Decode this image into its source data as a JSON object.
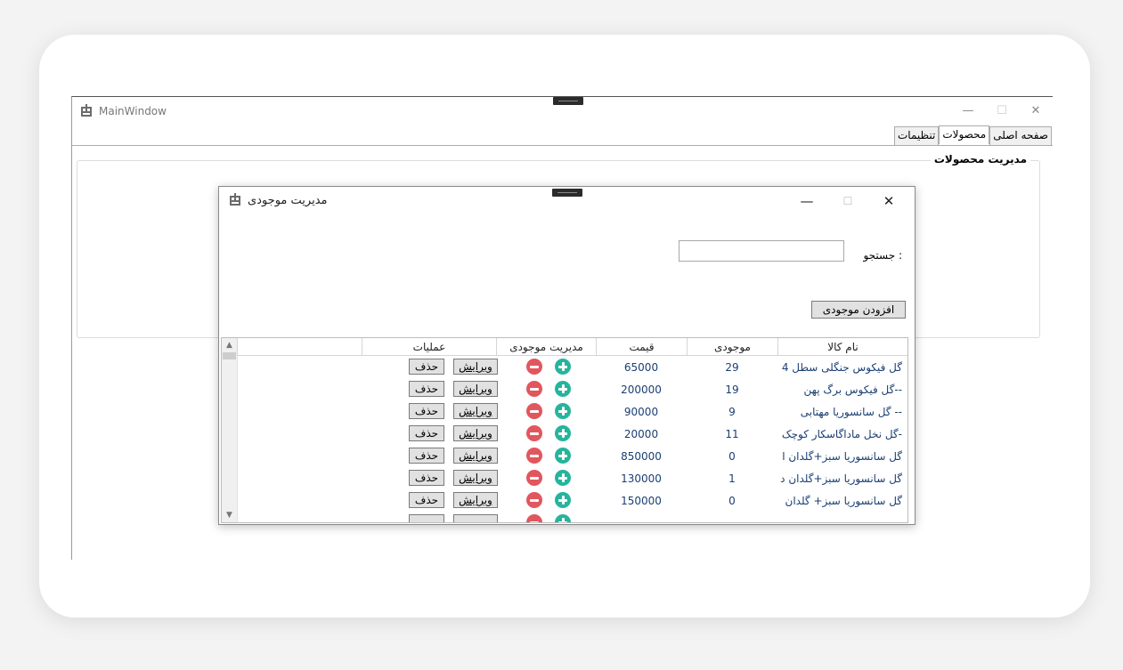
{
  "main_window": {
    "title": "MainWindow",
    "caption": {
      "minimize": "—",
      "maximize": "☐",
      "close": "✕"
    },
    "tabs": [
      {
        "label": "صفحه اصلی"
      },
      {
        "label": "محصولات",
        "active": true
      },
      {
        "label": "تنظیمات"
      }
    ],
    "group_title": "مدیریت محصولات"
  },
  "dialog": {
    "title": "مدیریت موجودی",
    "caption": {
      "minimize": "—",
      "maximize": "☐",
      "close": "✕"
    },
    "search_label": "جستجو :",
    "search_value": "",
    "add_button": "افزودن موجودی",
    "columns": {
      "name": "نام کالا",
      "stock": "موجودی",
      "price": "قیمت",
      "stock_mgmt": "مدیریت موجودی",
      "ops": "عملیات"
    },
    "edit_label": "ویرایش",
    "delete_label": "حذف",
    "rows": [
      {
        "name": "گل فیکوس جنگلی سطل 4",
        "stock": "29",
        "price": "65000"
      },
      {
        "name": "گل فیکوس برگ پهن--",
        "stock": "19",
        "price": "200000"
      },
      {
        "name": "گل سانسوریا مهتابی --",
        "stock": "9",
        "price": "90000"
      },
      {
        "name": "گل نخل ماداگاسکار کوچک-",
        "stock": "11",
        "price": "20000"
      },
      {
        "name": "گل سانسوریا سبز+گلدان ا",
        "stock": "0",
        "price": "850000"
      },
      {
        "name": "گل سانسوریا سبز+گلدان د",
        "stock": "1",
        "price": "130000"
      },
      {
        "name": "گل سانسوریا سبز+ گلدان",
        "stock": "0",
        "price": "150000"
      }
    ]
  },
  "icons": [
    "app-icon",
    "minimize-icon",
    "maximize-icon",
    "close-icon",
    "minus-circle-icon",
    "plus-circle-icon",
    "scroll-up-icon",
    "scroll-down-icon"
  ],
  "colors": {
    "minus": "#e2565e",
    "plus": "#25b59c",
    "cell_text": "#1a3f73"
  }
}
